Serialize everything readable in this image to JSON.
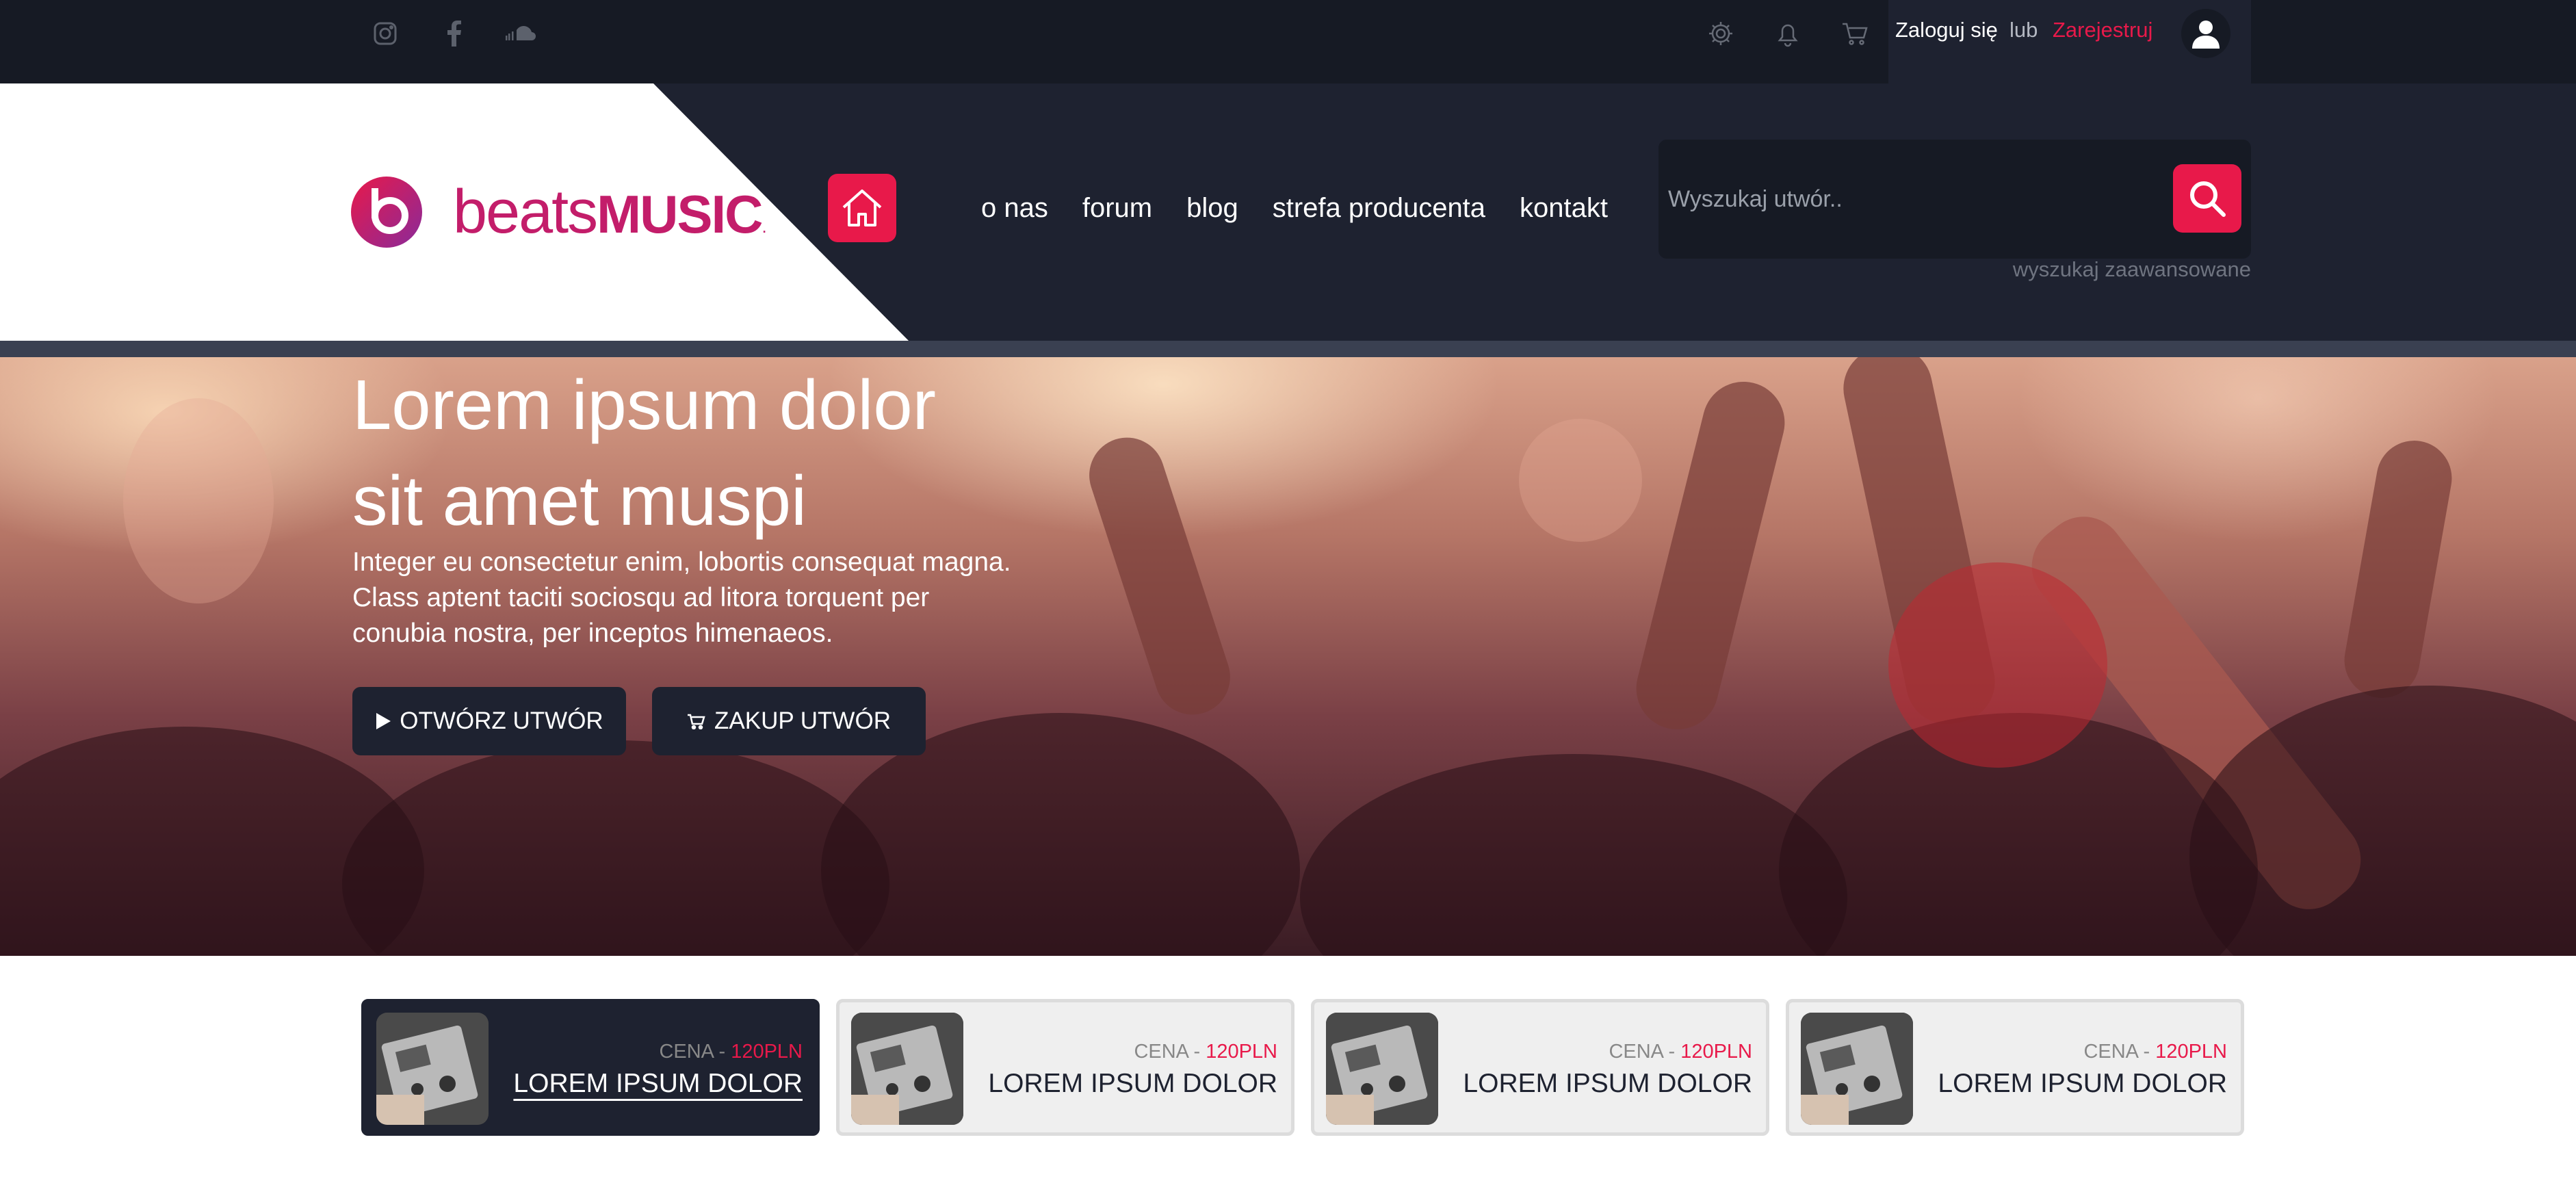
{
  "topbar": {
    "social_icons": [
      "instagram-icon",
      "facebook-icon",
      "soundcloud-icon"
    ],
    "action_icons": [
      "settings-icon",
      "notifications-icon",
      "cart-icon"
    ],
    "login_label": "Zaloguj się",
    "or_label": "lub",
    "register_label": "Zarejestruj",
    "avatar_icon": "user-icon"
  },
  "header": {
    "logo": {
      "text_light": "beats",
      "text_bold": "MUSIC",
      "mark": "."
    },
    "home_icon": "home-icon",
    "nav": [
      "o nas",
      "forum",
      "blog",
      "strefa producenta",
      "kontakt"
    ],
    "search": {
      "placeholder": "Wyszukaj utwór..",
      "button_icon": "search-icon",
      "advanced_label": "wyszukaj zaawansowane"
    }
  },
  "hero": {
    "title_lines": [
      "Lorem ipsum dolor",
      "sit amet muspi"
    ],
    "text_lines": [
      "Integer eu consectetur enim, lobortis consequat magna.",
      "Class aptent taciti sociosqu ad litora torquent per",
      "conubia nostra, per inceptos himenaeos."
    ],
    "buttons": [
      {
        "icon": "play-icon",
        "label": "OTWÓRZ UTWÓR"
      },
      {
        "icon": "cart-icon",
        "label": "ZAKUP UTWÓR"
      }
    ]
  },
  "products": [
    {
      "price_label": "CENA - ",
      "price_value": "120PLN",
      "name": "LOREM IPSUM DOLOR",
      "active": true
    },
    {
      "price_label": "CENA - ",
      "price_value": "120PLN",
      "name": "LOREM IPSUM DOLOR",
      "active": false
    },
    {
      "price_label": "CENA - ",
      "price_value": "120PLN",
      "name": "LOREM IPSUM DOLOR",
      "active": false
    },
    {
      "price_label": "CENA - ",
      "price_value": "120PLN",
      "name": "LOREM IPSUM DOLOR",
      "active": false
    }
  ],
  "colors": {
    "accent": "#e8194a",
    "dark": "#1e2230",
    "darker": "#161a24",
    "logo": "#c31d6a"
  }
}
